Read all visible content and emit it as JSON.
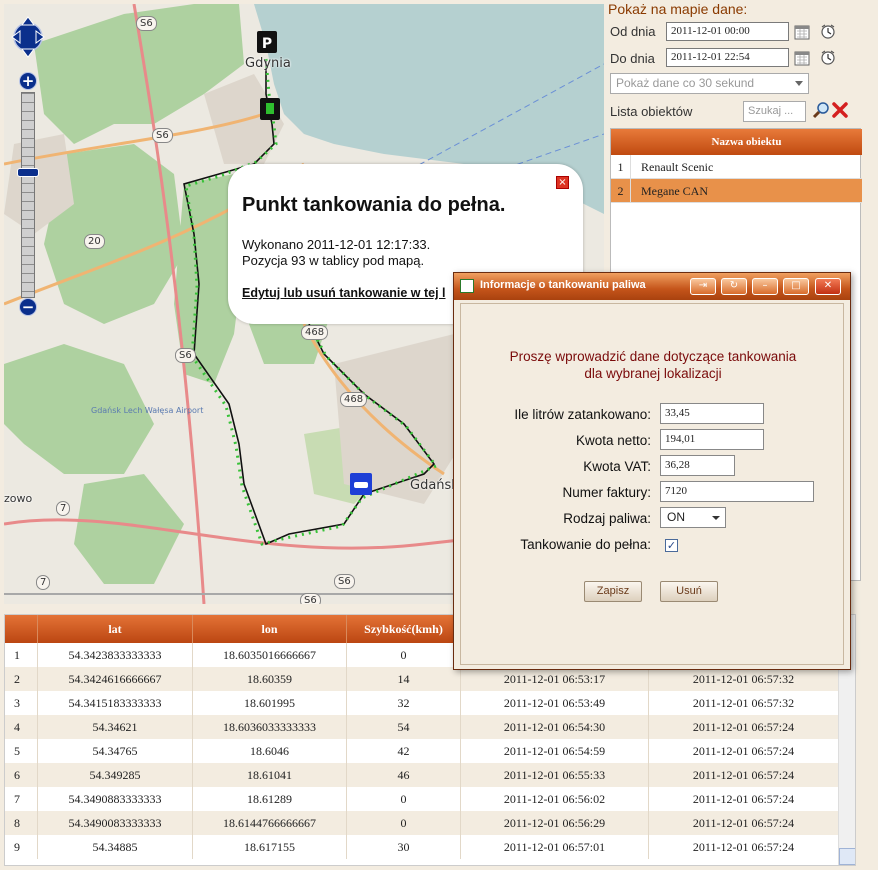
{
  "map": {
    "labels": {
      "gdynia": "Gdynia",
      "gdansk": "Gdańsk",
      "left_edge": "zowo",
      "airport": "Gdańsk Lech Wałęsa Airport"
    },
    "road_shields": [
      "S6",
      "S6",
      "S6",
      "20",
      "7",
      "7",
      "468",
      "468",
      "S6",
      "S6"
    ],
    "popup": {
      "title": "Punkt tankowania do pełna.",
      "line1": "Wykonano 2011-12-01 12:17:33.",
      "line2": "Pozycja 93 w tablicy pod mapą.",
      "link": "Edytuj lub usuń tankowanie w tej l",
      "close": "×"
    },
    "zoom": {
      "plus": "+",
      "minus": "−"
    }
  },
  "panel": {
    "title": "Pokaż na mapie dane:",
    "from_label": "Od dnia",
    "from_value": "2011-12-01 00:00",
    "to_label": "Do dnia",
    "to_value": "2011-12-01 22:54",
    "interval_placeholder": "Pokaż dane co 30 sekund",
    "objects_label": "Lista obiektów",
    "search_placeholder": "Szukaj ...",
    "objects_header": "Nazwa obiektu",
    "objects": [
      {
        "n": "1",
        "name": "Renault Scenic"
      },
      {
        "n": "2",
        "name": "Megane CAN"
      }
    ]
  },
  "table": {
    "headers": [
      "lat",
      "lon",
      "Szybkość(kmh)",
      "",
      ""
    ],
    "rows": [
      [
        "1",
        "54.3423833333333",
        "18.6035016666667",
        "0",
        "",
        ""
      ],
      [
        "2",
        "54.3424616666667",
        "18.60359",
        "14",
        "2011-12-01 06:53:17",
        "2011-12-01 06:57:32"
      ],
      [
        "3",
        "54.3415183333333",
        "18.601995",
        "32",
        "2011-12-01 06:53:49",
        "2011-12-01 06:57:32"
      ],
      [
        "4",
        "54.34621",
        "18.6036033333333",
        "54",
        "2011-12-01 06:54:30",
        "2011-12-01 06:57:24"
      ],
      [
        "5",
        "54.34765",
        "18.6046",
        "42",
        "2011-12-01 06:54:59",
        "2011-12-01 06:57:24"
      ],
      [
        "6",
        "54.349285",
        "18.61041",
        "46",
        "2011-12-01 06:55:33",
        "2011-12-01 06:57:24"
      ],
      [
        "7",
        "54.3490883333333",
        "18.61289",
        "0",
        "2011-12-01 06:56:02",
        "2011-12-01 06:57:24"
      ],
      [
        "8",
        "54.3490083333333",
        "18.6144766666667",
        "0",
        "2011-12-01 06:56:29",
        "2011-12-01 06:57:24"
      ],
      [
        "9",
        "54.34885",
        "18.617155",
        "30",
        "2011-12-01 06:57:01",
        "2011-12-01 06:57:24"
      ]
    ]
  },
  "dialog": {
    "title": "Informacje o tankowaniu paliwa",
    "heading1": "Proszę wprowadzić dane dotyczące tankowania",
    "heading2": "dla wybranej lokalizacji",
    "liters_label": "Ile litrów zatankowano:",
    "liters_value": "33,45",
    "net_label": "Kwota netto:",
    "net_value": "194,01",
    "vat_label": "Kwota VAT:",
    "vat_value": "36,28",
    "invoice_label": "Numer faktury:",
    "invoice_value": "7120",
    "fuel_label": "Rodzaj paliwa:",
    "fuel_value": "ON",
    "full_label": "Tankowanie do pełna:",
    "full_checked": true,
    "save": "Zapisz",
    "delete": "Usuń",
    "buttons": {
      "check": "✓"
    }
  }
}
